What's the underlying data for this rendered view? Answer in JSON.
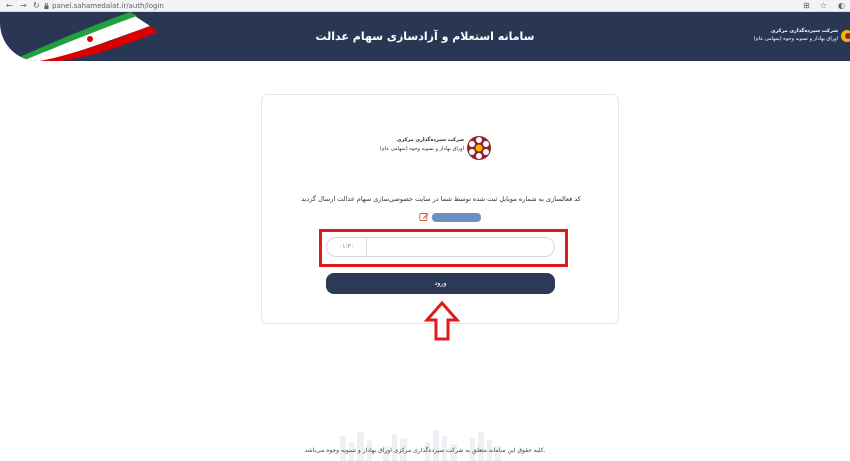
{
  "browser": {
    "back_icon": "←",
    "forward_icon": "→",
    "reload_icon": "↻",
    "url": "panel.sahamedalat.ir/auth/login",
    "translate_icon": "⊞",
    "star_icon": "☆",
    "profile_icon": "◐"
  },
  "header": {
    "title": "سامانه استعلام و آزادسازی سهام عدالت",
    "logo_line1": "شرکت سپرده‌گذاری مرکزی",
    "logo_line2": "اوراق بهادار و تسویه وجوه (سهامی عام)"
  },
  "card": {
    "logo_line1": "شرکت سپرده‌گذاری مرکزی",
    "logo_line2": "اوراق بهادار و تسویه وجوه (سهامی عام)",
    "instruction": "کد فعالسازی به شماره موبایل ثبت شده توسط شما در سایت خصوصی‌سازی سهام عدالت ارسال گردید",
    "timer": "۰۱:۳۰",
    "login_label": "ورود"
  },
  "footer": {
    "text": ".کلیه حقوق این سامانه متعلق به شرکت سپرده‌گذاری مرکزی اوراق بهادار و تسویه وجوه می‌باشد"
  },
  "colors": {
    "header_bg": "#293755",
    "button_bg": "#2c3a58",
    "highlight": "#e01b1b",
    "phone_pill": "#6f8fc1"
  }
}
